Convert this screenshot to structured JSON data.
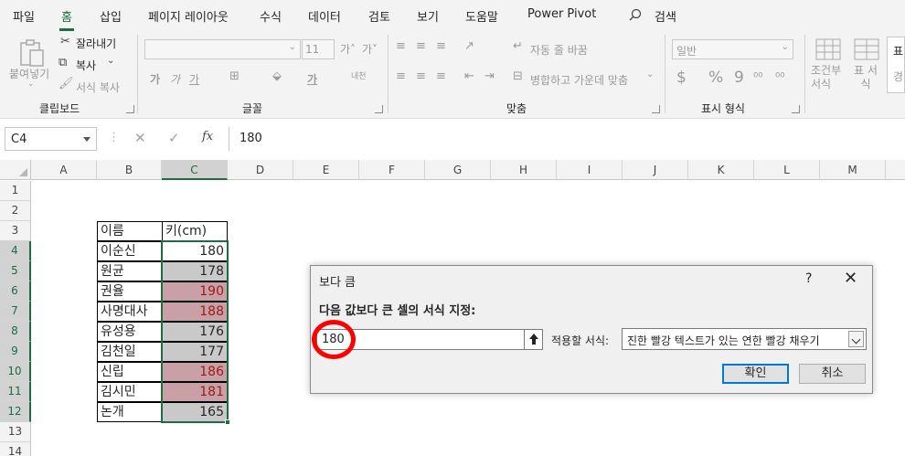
{
  "menu": {
    "tabs": [
      {
        "label": "파일"
      },
      {
        "label": "홈"
      },
      {
        "label": "삽입"
      },
      {
        "label": "페이지 레이아웃"
      },
      {
        "label": "수식"
      },
      {
        "label": "데이터"
      },
      {
        "label": "검토"
      },
      {
        "label": "보기"
      },
      {
        "label": "도움말"
      },
      {
        "label": "Power Pivot"
      }
    ],
    "active_tab": "홈",
    "search_label": "검색"
  },
  "ribbon": {
    "clipboard": {
      "group_label": "클립보드",
      "paste": "붙여넣기",
      "cut": "잘라내기",
      "copy": "복사",
      "format_painter": "서식 복사"
    },
    "font": {
      "group_label": "글꼴",
      "font_size": "11",
      "grow": "가˄",
      "shrink": "가˅",
      "bold": "가",
      "italic": "가",
      "underline": "가",
      "font_color": "가",
      "phonetic": "내천"
    },
    "alignment": {
      "group_label": "맞춤",
      "wrap_text": "자동 줄 바꿈",
      "merge_center": "병합하고 가운데 맞춤"
    },
    "number": {
      "group_label": "표시 형식",
      "format": "일반",
      "currency": "$",
      "percent": "%",
      "comma": "9"
    },
    "styles": {
      "conditional": "조건부 서식",
      "table": "표 서식",
      "cell_styles_top": "표",
      "cell_styles_bottom": "경"
    }
  },
  "formula_bar": {
    "name_box": "C4",
    "fx": "fx",
    "value": "180"
  },
  "sheet": {
    "columns": [
      "A",
      "B",
      "C",
      "D",
      "E",
      "F",
      "G",
      "H",
      "I",
      "J",
      "K",
      "L",
      "M"
    ],
    "selected_column": "C",
    "rows": [
      "1",
      "2",
      "3",
      "4",
      "5",
      "6",
      "7",
      "8",
      "9",
      "10",
      "11",
      "12",
      "13",
      "14"
    ],
    "selected_rows": [
      "4",
      "5",
      "6",
      "7",
      "8",
      "9",
      "10",
      "11",
      "12"
    ],
    "table_header": {
      "name": "이름",
      "height": "키(cm)"
    },
    "table_rows": [
      {
        "name": "이순신",
        "height": "180",
        "highlight": false
      },
      {
        "name": "원균",
        "height": "178",
        "highlight": false
      },
      {
        "name": "권율",
        "height": "190",
        "highlight": true
      },
      {
        "name": "사명대사",
        "height": "188",
        "highlight": true
      },
      {
        "name": "유성용",
        "height": "176",
        "highlight": false
      },
      {
        "name": "김천일",
        "height": "177",
        "highlight": false
      },
      {
        "name": "신립",
        "height": "186",
        "highlight": true
      },
      {
        "name": "김시민",
        "height": "181",
        "highlight": true
      },
      {
        "name": "논개",
        "height": "165",
        "highlight": false
      }
    ]
  },
  "dialog": {
    "title": "보다 큼",
    "help": "?",
    "close": "✕",
    "prompt": "다음 값보다 큰 셀의 서식 지정:",
    "value": "180",
    "format_label": "적용할 서식:",
    "format_value": "진한 빨강 텍스트가 있는 연한 빨강 채우기",
    "ok": "확인",
    "cancel": "취소"
  },
  "colors": {
    "accent": "#1e6c41",
    "highlight_fill": "#c9a0a5",
    "highlight_text": "#9c1a1a",
    "annotation_red": "#ff0000"
  }
}
